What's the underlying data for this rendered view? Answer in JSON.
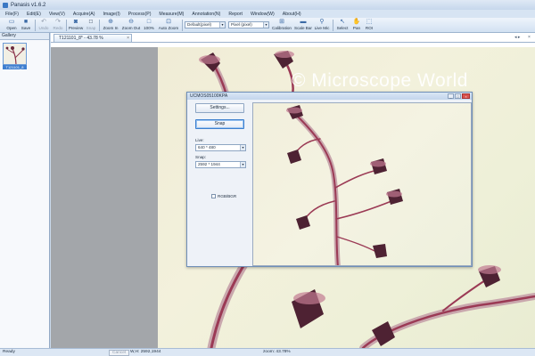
{
  "window": {
    "title": "Panasis v1.6.2"
  },
  "menu": [
    "File(F)",
    "Edit(E)",
    "View(V)",
    "Acquire(A)",
    "Image(I)",
    "Process(P)",
    "Measure(M)",
    "Annotation(N)",
    "Report",
    "Window(W)",
    "About(H)"
  ],
  "toolbar": {
    "open": "Open",
    "save": "Save",
    "undo": "Undo",
    "redo": "Redo",
    "preview": "Preview",
    "snap": "Snap",
    "zoom_in": "Zoom In",
    "zoom_out": "Zoom Out",
    "zoom_100": "100%",
    "auto_zoom": "Auto Zoom",
    "unit_combo": "Default(pixel)",
    "pixel_combo": "Pixel (pixel)",
    "calibration": "Calibration",
    "scale_bar": "Scale Bar",
    "live_mic": "Live Mic",
    "select": "Select",
    "pan": "Pan",
    "roi": "ROI"
  },
  "gallery": {
    "header": "Gallery",
    "thumb_label": "T121101_8"
  },
  "document": {
    "tab_label": "T121101_8* - 43.78 %"
  },
  "watermark": "© Microscope World",
  "dialog": {
    "title": "UCMOS05100KPA",
    "settings_button": "Settings...",
    "snap_button": "Snap",
    "live_label": "Live:",
    "live_value": "640 * 480",
    "snap_label": "Snap:",
    "snap_value": "2592 * 1944",
    "rgb_label": "RGB/BGR"
  },
  "status": {
    "ready": "Ready",
    "cancel": "Cancel",
    "dimensions": "W,H: 2592,1944",
    "zoom": "zoom: 43.78%"
  },
  "colors": {
    "accent": "#3f7fd0",
    "chrome": "#c9d9ec",
    "specimen": "#9b3a55"
  }
}
